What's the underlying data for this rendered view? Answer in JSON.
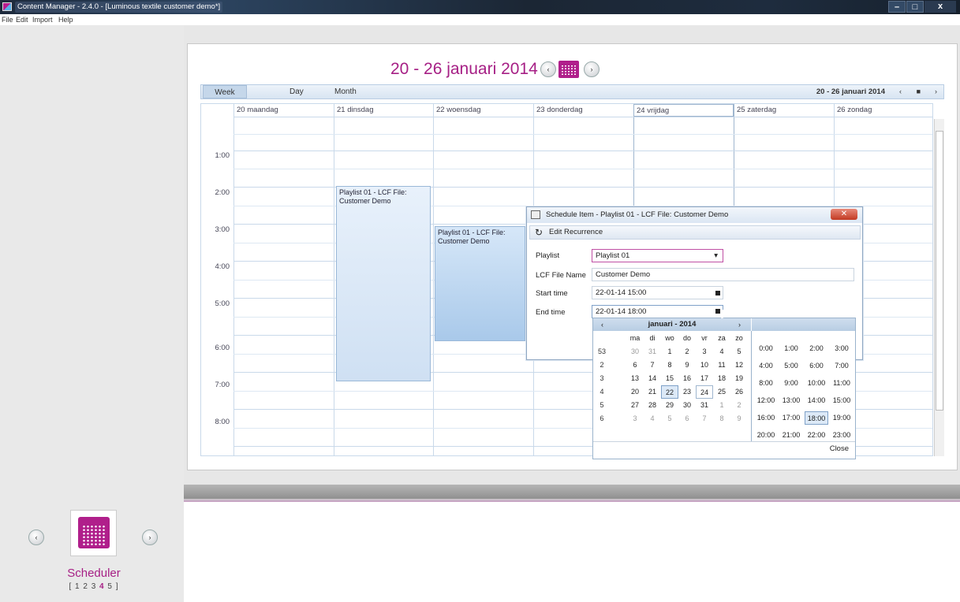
{
  "window": {
    "title": "Content Manager - 2.4.0 - [Luminous textile customer demo*]",
    "min": "–",
    "max": "□",
    "close": "x"
  },
  "menu": {
    "file": "File",
    "edit": "Edit",
    "import": "Import",
    "help": "Help"
  },
  "calendar": {
    "title": "20  - 26 januari 2014",
    "views": {
      "week": "Week",
      "day": "Day",
      "month": "Month"
    },
    "range": "20  - 26 januari 2014",
    "nav_prev": "‹",
    "nav_mid": "■",
    "nav_next": "›",
    "days": [
      "20 maandag",
      "21 dinsdag",
      "22 woensdag",
      "23 donderdag",
      "24 vrijdag",
      "25 zaterdag",
      "26 zondag"
    ],
    "hours": [
      "1:00",
      "2:00",
      "3:00",
      "4:00",
      "5:00",
      "6:00",
      "7:00",
      "8:00"
    ],
    "appointments": [
      {
        "text": "Playlist 01 - LCF File: Customer Demo"
      },
      {
        "text": "Playlist 01 - LCF File: Customer Demo"
      }
    ]
  },
  "dialog": {
    "title": "Schedule Item - Playlist 01 - LCF File: Customer Demo",
    "close": "✕",
    "edit_recurrence": "Edit Recurrence",
    "recurrence_icon": "↻",
    "playlist_label": "Playlist",
    "playlist_value": "Playlist 01",
    "playlist_arrow": "▾",
    "lcf_label": "LCF File Name",
    "lcf_value": "Customer Demo",
    "start_label": "Start time",
    "start_value": "22-01-14 15:00",
    "end_label": "End time",
    "end_value": "22-01-14 18:00"
  },
  "datepicker": {
    "month": "januari - 2014",
    "prev": "‹",
    "next": "›",
    "weekdays": [
      "ma",
      "di",
      "wo",
      "do",
      "vr",
      "za",
      "zo"
    ],
    "weeks": [
      {
        "wk": "53",
        "days": [
          "30",
          "31",
          "1",
          "2",
          "3",
          "4",
          "5"
        ]
      },
      {
        "wk": "2",
        "days": [
          "6",
          "7",
          "8",
          "9",
          "10",
          "11",
          "12"
        ]
      },
      {
        "wk": "3",
        "days": [
          "13",
          "14",
          "15",
          "16",
          "17",
          "18",
          "19"
        ]
      },
      {
        "wk": "4",
        "days": [
          "20",
          "21",
          "22",
          "23",
          "24",
          "25",
          "26"
        ]
      },
      {
        "wk": "5",
        "days": [
          "27",
          "28",
          "29",
          "30",
          "31",
          "1",
          "2"
        ]
      },
      {
        "wk": "6",
        "days": [
          "3",
          "4",
          "5",
          "6",
          "7",
          "8",
          "9"
        ]
      }
    ],
    "selected_day": "22",
    "today": "24",
    "times": [
      "0:00",
      "1:00",
      "2:00",
      "3:00",
      "4:00",
      "5:00",
      "6:00",
      "7:00",
      "8:00",
      "9:00",
      "10:00",
      "11:00",
      "12:00",
      "13:00",
      "14:00",
      "15:00",
      "16:00",
      "17:00",
      "18:00",
      "19:00",
      "20:00",
      "21:00",
      "22:00",
      "23:00"
    ],
    "selected_time": "18:00",
    "close": "Close"
  },
  "scheduler": {
    "label": "Scheduler",
    "pages_prefix": "[ 1 2 3 ",
    "pages_current": "4",
    "pages_suffix": " 5 ]",
    "prev": "‹",
    "next": "›"
  },
  "colors": {
    "accent": "#a61f85",
    "grid": "#c9d9ea"
  }
}
